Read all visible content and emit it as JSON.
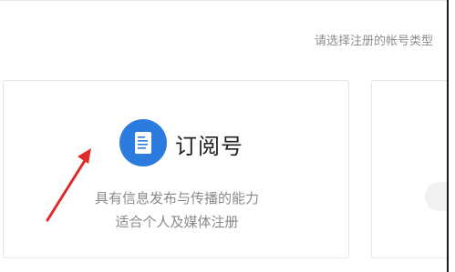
{
  "header": {
    "hint": "请选择注册的帐号类型"
  },
  "cards": [
    {
      "title": "订阅号",
      "icon": "document-icon",
      "description": [
        "具有信息发布与传播的能力",
        "适合个人及媒体注册"
      ]
    }
  ],
  "colors": {
    "accent": "#2c7bde",
    "annotation": "#e02a2a",
    "text_muted": "#8a8a8a",
    "border": "#e6e6e6"
  }
}
